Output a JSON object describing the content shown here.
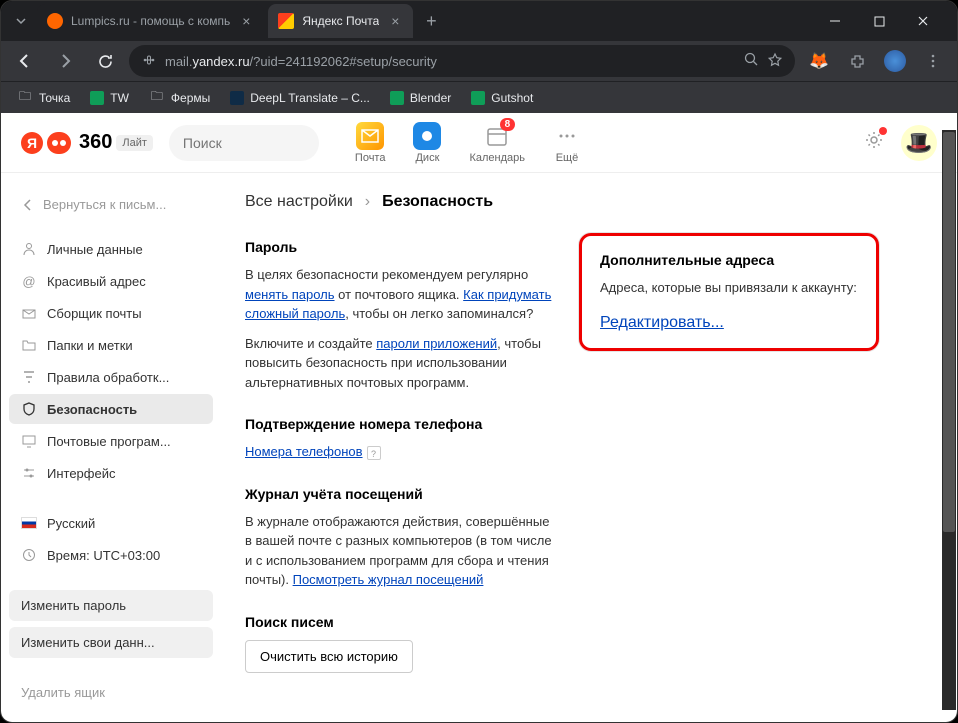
{
  "browser": {
    "tabs": [
      {
        "title": "Lumpics.ru - помощь с компь",
        "favicon_color": "#ff6600"
      },
      {
        "title": "Яндекс Почта",
        "favicon_color": "#fc3f1d"
      }
    ],
    "url_prefix": "mail.",
    "url_domain": "yandex.ru",
    "url_path": "/?uid=241192062#setup/security",
    "bookmarks": [
      {
        "label": "Точка",
        "icon": "folder"
      },
      {
        "label": "TW",
        "icon": "sheet"
      },
      {
        "label": "Фермы",
        "icon": "folder"
      },
      {
        "label": "DeepL Translate – С...",
        "icon": "deepl"
      },
      {
        "label": "Blender",
        "icon": "sheet"
      },
      {
        "label": "Gutshot",
        "icon": "sheet"
      }
    ]
  },
  "header": {
    "logo_text": "360",
    "logo_badge": "Лайт",
    "search_placeholder": "Поиск",
    "apps": [
      {
        "label": "Почта",
        "color": "#ffcc00"
      },
      {
        "label": "Диск",
        "color": "#1e88e5"
      },
      {
        "label": "Календарь",
        "color": "#fff",
        "badge": "8"
      },
      {
        "label": "Ещё",
        "color": "#fff"
      }
    ]
  },
  "sidebar": {
    "back": "Вернуться к письм...",
    "items": [
      {
        "label": "Личные данные",
        "icon": "person"
      },
      {
        "label": "Красивый адрес",
        "icon": "at"
      },
      {
        "label": "Сборщик почты",
        "icon": "inbox"
      },
      {
        "label": "Папки и метки",
        "icon": "folder"
      },
      {
        "label": "Правила обработк...",
        "icon": "filter"
      },
      {
        "label": "Безопасность",
        "icon": "shield",
        "active": true
      },
      {
        "label": "Почтовые програм...",
        "icon": "monitor"
      },
      {
        "label": "Интерфейс",
        "icon": "sliders"
      }
    ],
    "lang": "Русский",
    "time": "Время: UTC+03:00",
    "btn1": "Изменить пароль",
    "btn2": "Изменить свои данн...",
    "delete": "Удалить ящик"
  },
  "breadcrumb": {
    "all": "Все настройки",
    "current": "Безопасность"
  },
  "sections": {
    "password": {
      "title": "Пароль",
      "text1a": "В целях безопасности рекомендуем регулярно ",
      "link1": "менять пароль",
      "text1b": " от почтового ящика. ",
      "link2": "Как придумать сложный пароль",
      "text1c": ", чтобы он легко запоминался?",
      "text2a": "Включите и создайте ",
      "link3": "пароли приложений",
      "text2b": ", чтобы повысить безопасность при использовании альтернативных почтовых программ."
    },
    "phone": {
      "title": "Подтверждение номера телефона",
      "link": "Номера телефонов"
    },
    "journal": {
      "title": "Журнал учёта посещений",
      "text1": "В журнале отображаются действия, совершённые в вашей почте с разных компьютеров (в том числе и с использованием программ для сбора и чтения почты). ",
      "link": "Посмотреть журнал посещений"
    },
    "search": {
      "title": "Поиск писем",
      "button": "Очистить всю историю"
    },
    "addresses": {
      "title": "Дополнительные адреса",
      "text": "Адреса, которые вы привязали к аккаунту:",
      "link": "Редактировать..."
    }
  }
}
